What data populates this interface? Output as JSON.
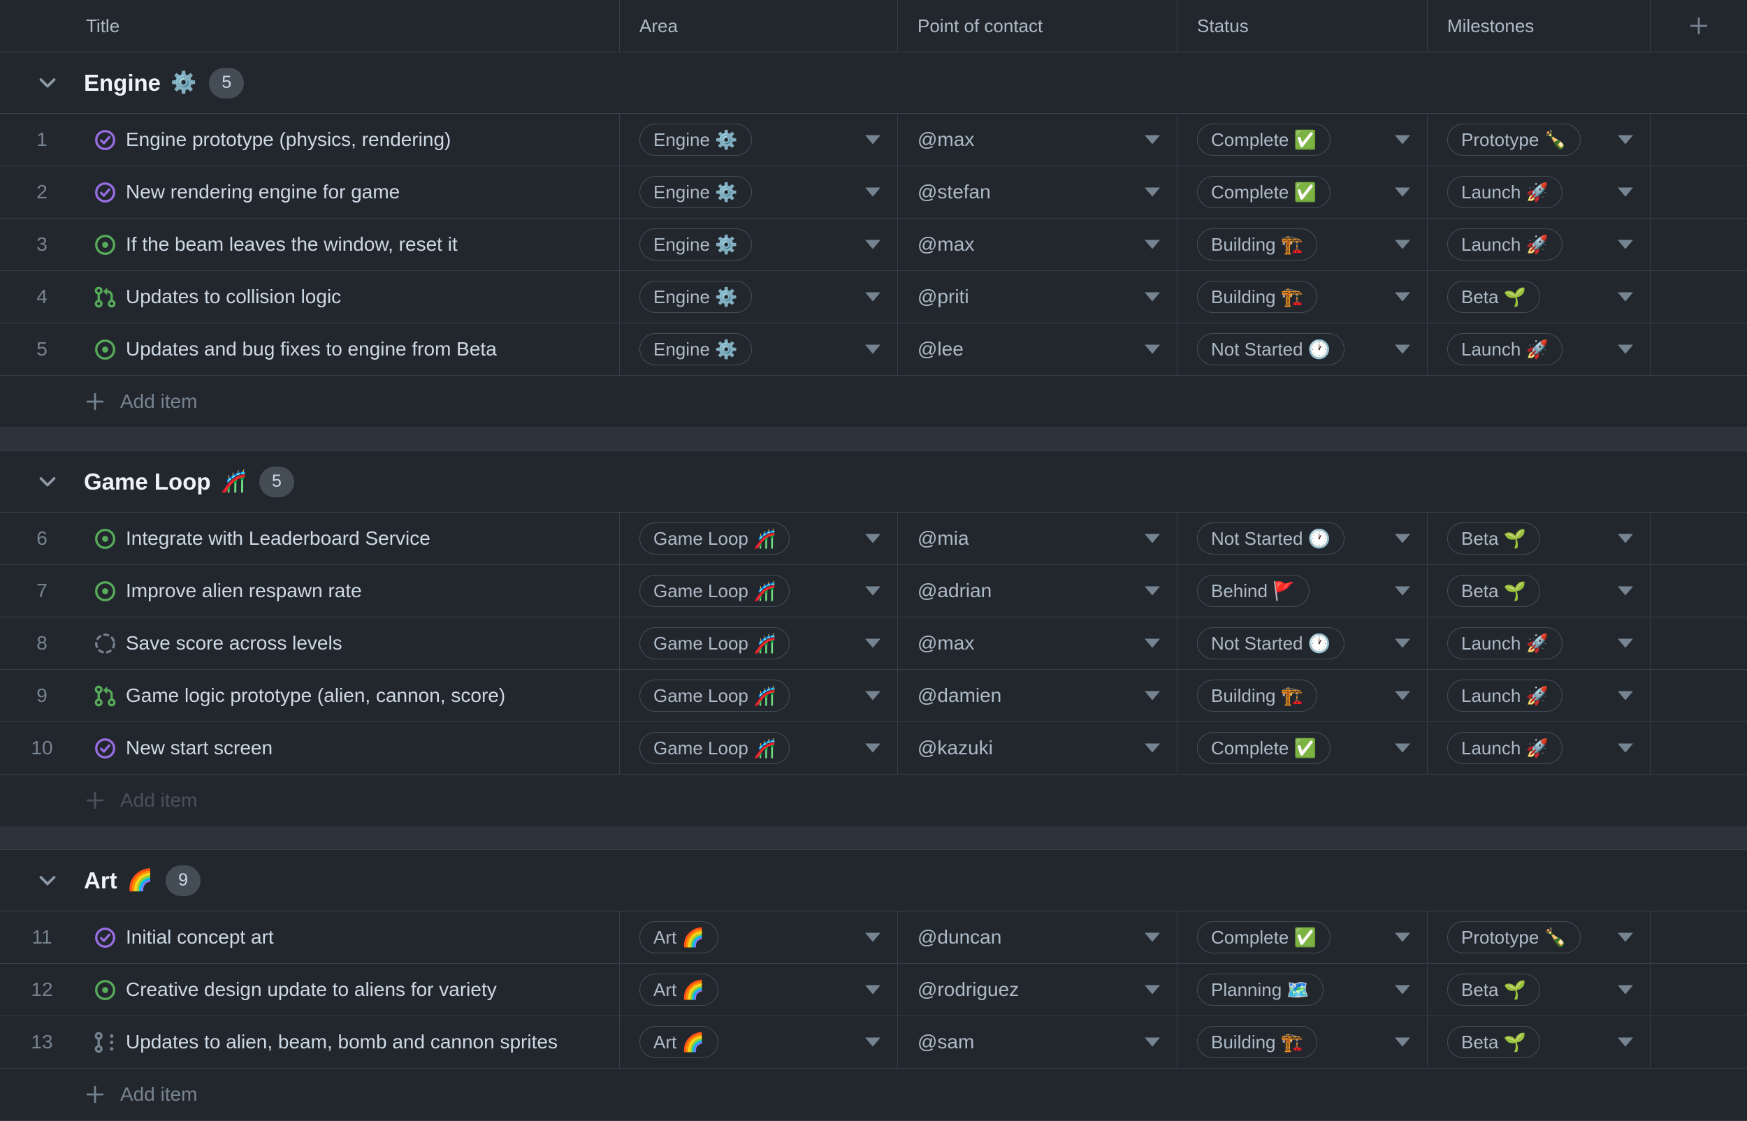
{
  "table": {
    "columns": [
      {
        "label": "Title"
      },
      {
        "label": "Area"
      },
      {
        "label": "Point of contact"
      },
      {
        "label": "Status"
      },
      {
        "label": "Milestones"
      }
    ],
    "add_item_label": "Add item"
  },
  "colors": {
    "background": "#22272e",
    "section_gap": "#2d333b",
    "border": "#373e47",
    "pill_border": "#444c56",
    "text_bright": "#cdd9e5",
    "text": "#adbac7",
    "muted": "#768390",
    "issue_open_green": "#57ab5a",
    "issue_closed_purple": "#986ee2"
  },
  "sections": [
    {
      "name": "Engine",
      "emoji": "⚙️",
      "count": "5",
      "rows": [
        {
          "num": "1",
          "icon": "issue-closed",
          "title": "Engine prototype (physics, rendering)",
          "area": "Engine ⚙️",
          "poc": "@max",
          "status": "Complete ✅",
          "milestone": "Prototype 🍾"
        },
        {
          "num": "2",
          "icon": "issue-closed",
          "title": "New rendering engine for game",
          "area": "Engine ⚙️",
          "poc": "@stefan",
          "status": "Complete ✅",
          "milestone": "Launch 🚀"
        },
        {
          "num": "3",
          "icon": "issue-open",
          "title": "If the beam leaves the window, reset it",
          "area": "Engine ⚙️",
          "poc": "@max",
          "status": "Building 🏗️",
          "milestone": "Launch 🚀"
        },
        {
          "num": "4",
          "icon": "pull-request",
          "title": "Updates to collision logic",
          "area": "Engine ⚙️",
          "poc": "@priti",
          "status": "Building 🏗️",
          "milestone": "Beta 🌱"
        },
        {
          "num": "5",
          "icon": "issue-open",
          "title": "Updates and bug fixes to engine from Beta",
          "area": "Engine ⚙️",
          "poc": "@lee",
          "status": "Not Started 🕐",
          "milestone": "Launch 🚀"
        }
      ]
    },
    {
      "name": "Game Loop",
      "emoji": "🎢",
      "count": "5",
      "rows": [
        {
          "num": "6",
          "icon": "issue-open",
          "title": "Integrate with Leaderboard Service",
          "area": "Game Loop 🎢",
          "poc": "@mia",
          "status": "Not Started 🕐",
          "milestone": "Beta 🌱"
        },
        {
          "num": "7",
          "icon": "issue-open",
          "title": "Improve alien respawn rate",
          "area": "Game Loop 🎢",
          "poc": "@adrian",
          "status": "Behind 🚩",
          "milestone": "Beta 🌱"
        },
        {
          "num": "8",
          "icon": "issue-draft",
          "title": "Save score across levels",
          "area": "Game Loop 🎢",
          "poc": "@max",
          "status": "Not Started 🕐",
          "milestone": "Launch 🚀"
        },
        {
          "num": "9",
          "icon": "pull-request",
          "title": "Game logic prototype (alien, cannon, score)",
          "area": "Game Loop 🎢",
          "poc": "@damien",
          "status": "Building 🏗️",
          "milestone": "Launch 🚀"
        },
        {
          "num": "10",
          "icon": "issue-closed",
          "title": "New start screen",
          "area": "Game Loop 🎢",
          "poc": "@kazuki",
          "status": "Complete ✅",
          "milestone": "Launch 🚀"
        }
      ]
    },
    {
      "name": "Art",
      "emoji": "🌈",
      "count": "9",
      "rows": [
        {
          "num": "11",
          "icon": "issue-closed",
          "title": "Initial concept art",
          "area": "Art 🌈",
          "poc": "@duncan",
          "status": "Complete ✅",
          "milestone": "Prototype 🍾"
        },
        {
          "num": "12",
          "icon": "issue-open",
          "title": "Creative design update to aliens for variety",
          "area": "Art 🌈",
          "poc": "@rodriguez",
          "status": "Planning 🗺️",
          "milestone": "Beta 🌱"
        },
        {
          "num": "13",
          "icon": "draft-pull-request",
          "title": "Updates to alien, beam, bomb and cannon sprites",
          "area": "Art 🌈",
          "poc": "@sam",
          "status": "Building 🏗️",
          "milestone": "Beta 🌱"
        }
      ]
    }
  ]
}
